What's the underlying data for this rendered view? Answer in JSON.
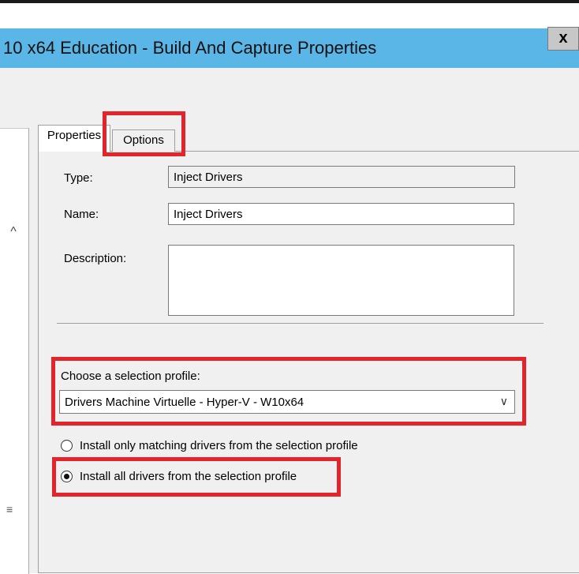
{
  "window": {
    "title": "10 x64 Education - Build And Capture Properties",
    "close_label": "x"
  },
  "tabs": [
    {
      "label": "Properties",
      "selected": true
    },
    {
      "label": "Options",
      "selected": false
    }
  ],
  "form": {
    "type_label": "Type:",
    "type_value": "Inject Drivers",
    "name_label": "Name:",
    "name_value": "Inject Drivers",
    "description_label": "Description:",
    "description_value": ""
  },
  "selection_profile": {
    "label": "Choose a selection profile:",
    "selected": "Drivers Machine Virtuelle - Hyper-V - W10x64"
  },
  "install_options": [
    {
      "label": "Install only matching drivers from the selection profile",
      "checked": false
    },
    {
      "label": "Install all drivers from the selection profile",
      "checked": true
    }
  ],
  "colors": {
    "title_bar": "#5ab6e6",
    "highlight": "#e3242b"
  }
}
